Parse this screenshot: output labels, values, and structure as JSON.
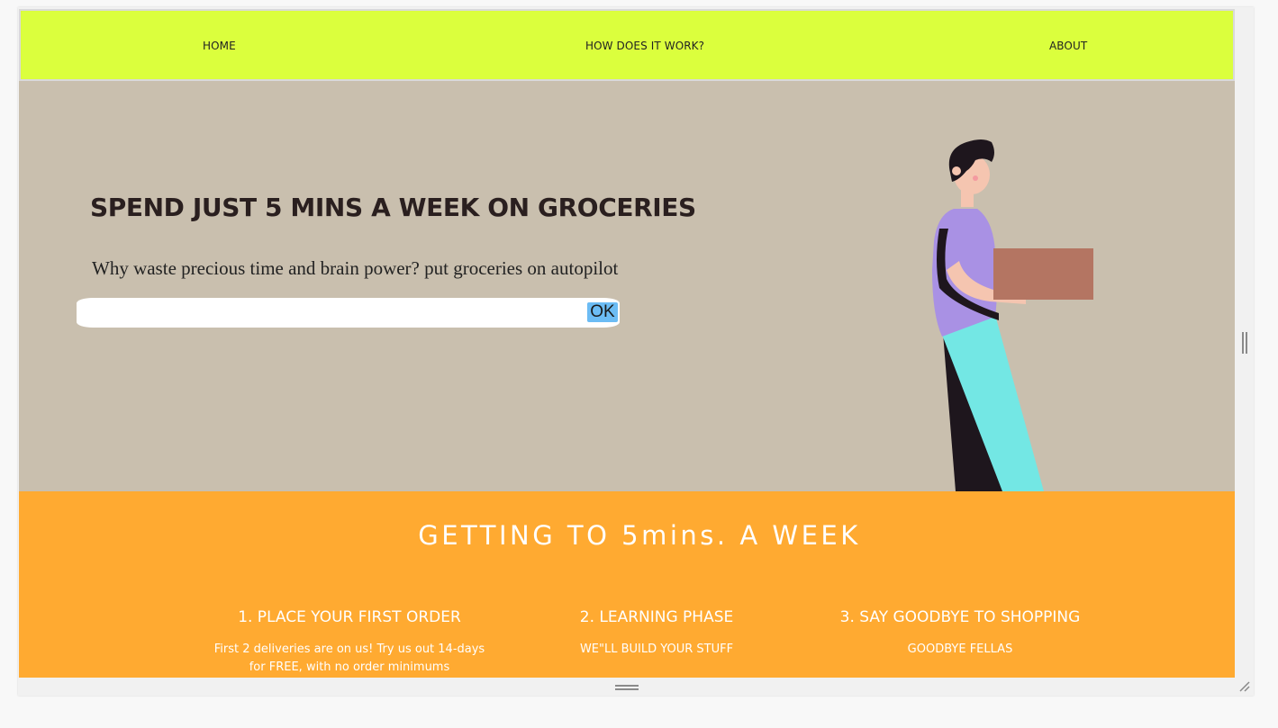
{
  "nav": {
    "items": [
      {
        "label": "HOME"
      },
      {
        "label": "HOW DOES IT WORK?"
      },
      {
        "label": "ABOUT"
      }
    ]
  },
  "hero": {
    "title": "SPEND JUST 5 MINS A WEEK ON GROCERIES",
    "subtitle": "Why waste precious time and brain power? put groceries on autopilot",
    "input_value": "",
    "button_label": "OK",
    "illustration": "person-carrying-box-illustration"
  },
  "steps": {
    "heading": "GETTING TO 5mins. A WEEK",
    "items": [
      {
        "title": "1. PLACE YOUR FIRST ORDER",
        "desc": "First 2 deliveries are on us! Try us out 14-days for FREE, with no order minimums"
      },
      {
        "title": "2. LEARNING PHASE",
        "desc": "WE\"LL BUILD YOUR STUFF"
      },
      {
        "title": "3. SAY GOODBYE TO SHOPPING",
        "desc": "GOODBYE FELLAS"
      }
    ]
  },
  "colors": {
    "nav_bg": "#dbff3d",
    "hero_bg": "#c9bfae",
    "steps_bg": "#ffaa31",
    "button_bg": "#6cbcf4"
  },
  "icons": [
    "vertical-resize-grip-icon",
    "horizontal-resize-grip-icon",
    "corner-resize-icon"
  ]
}
